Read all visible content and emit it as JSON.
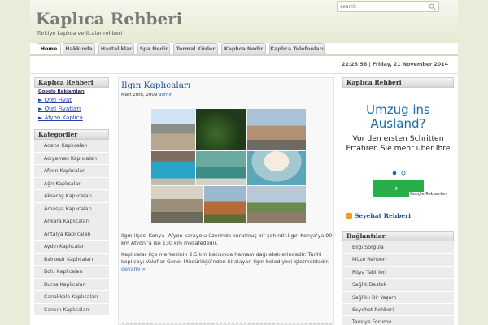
{
  "site": {
    "title": "Kaplıca Rehberi",
    "subtitle": "Türkiye kaplıca ve ilcalar rehberi"
  },
  "search": {
    "placeholder": "search"
  },
  "nav": {
    "tabs": [
      {
        "label": "Home"
      },
      {
        "label": "Hakkında"
      },
      {
        "label": "Hastalıklar"
      },
      {
        "label": "Spa Nedir"
      },
      {
        "label": "Termal Kürler"
      },
      {
        "label": "Kaplıca Nedir"
      },
      {
        "label": "Kaplıca Telefonları"
      }
    ],
    "active_tab": "Home"
  },
  "datetime": "22:23:56 | Friday, 21 November 2014",
  "left_sidebar": {
    "title": "Kaplıca Rehberi",
    "ad_label": "Google Reklamları",
    "ad_links": [
      "► Otel Fiyat",
      "► Otel Fiyatları",
      "► Afyon Kaplica"
    ],
    "categories_title": "Kategoriler",
    "categories": [
      "Adana Kaplıcaları",
      "Adıyaman Kaplıcaları",
      "Afyon Kaplıcaları",
      "Ağrı Kaplıcaları",
      "Aksaray Kaplıcaları",
      "Amasya Kaplıcaları",
      "Ankara Kaplıcaları",
      "Antalya Kaplıcaları",
      "Aydın Kaplıcaları",
      "Balıkesir Kaplıcaları",
      "Bolu Kaplıcaları",
      "Bursa Kaplıcaları",
      "Çanakkale Kaplıcaları",
      "Çankırı Kaplıcaları"
    ]
  },
  "post": {
    "title": "Ilgın Kaplıcaları",
    "date": "Mart 28th, 2009",
    "author": "admin",
    "paragraph1": "Ilgın ilçesi Konya- Afyon karayolu üzerinde kurulmuş bir şehirdir.Ilgın Konya'ya 90 km Afyon 'a ise 130 km mesafededir.",
    "paragraph2": "Kaplıcalar ilçe merkezinin 2.5 km batısında hamam dağı eteklerindedir. Tarihi kaplıcayı Vakıflar Genel Müdürlüğü'nden kiralayan Ilgın belediyesi işletmektedir.",
    "more": "devamı »"
  },
  "right_sidebar": {
    "title": "Kaplıca Rehberi",
    "ad": {
      "headline": "Umzug ins Ausland?",
      "body": "Vor den ersten Schritten Erfahren Sie mehr über Ihre",
      "google_label": "Google Reklamları",
      "button_symbol": "›"
    },
    "rss_title": "Seyehat Rehberi",
    "links_title": "Bağlantılar",
    "links": [
      "Bilgi Sorgula",
      "Müze Rehberi",
      "Rüya Tabirleri",
      "Sağlık Destek",
      "Sağlıklı Bir Yaşam",
      "Seyehat Rehberi",
      "Tavsiye Forumu"
    ]
  },
  "colors": {
    "background": "#e9ecd8",
    "link_blue": "#1e4e87",
    "ad_blue": "#1a6aa8",
    "ad_button_green": "#27ae48",
    "rss_orange": "#f29b2f"
  },
  "icons": [
    "search-icon",
    "rss-icon",
    "carousel-dots-icon",
    "arrow-right-icon"
  ]
}
